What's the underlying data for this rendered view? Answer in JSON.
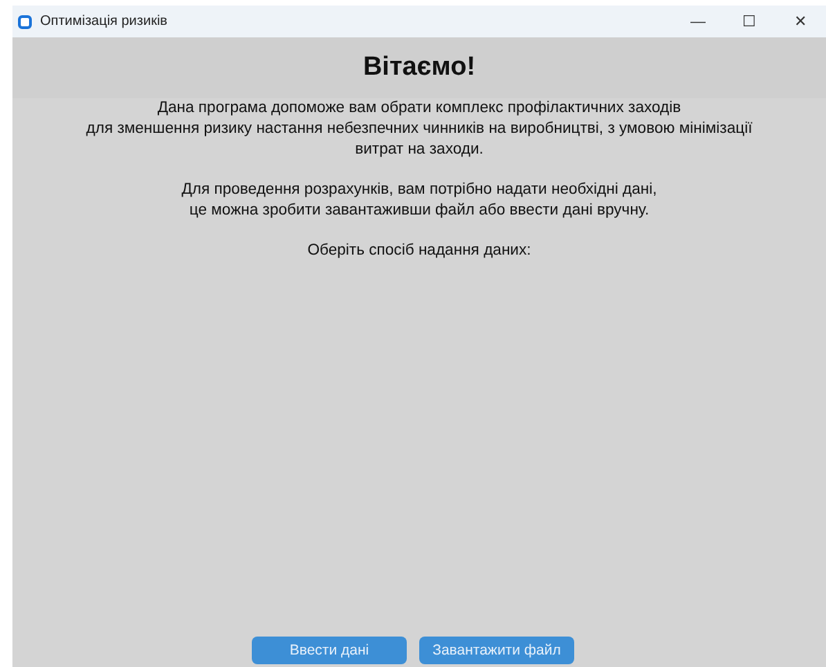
{
  "window": {
    "title": "Оптимізація ризиків",
    "controls": [
      "—",
      "☐",
      "✕"
    ]
  },
  "heading": "Вітаємо!",
  "paragraphs": [
    {
      "lines": [
        "Дана програма допоможе вам обрати комплекс профілактичних заходів",
        "для зменшення ризику настання небезпечних чинників на виробництві, з умовою мінімізації",
        "витрат на заходи."
      ]
    },
    {
      "lines": [
        "Для проведення розрахунків, вам потрібно надати необхідні дані,",
        "це можна зробити завантаживши файл або ввести дані вручну."
      ]
    },
    {
      "lines": [
        "Оберіть спосіб надання даних:"
      ]
    }
  ],
  "buttons": [
    "Ввести дані",
    "Завантажити файл"
  ]
}
